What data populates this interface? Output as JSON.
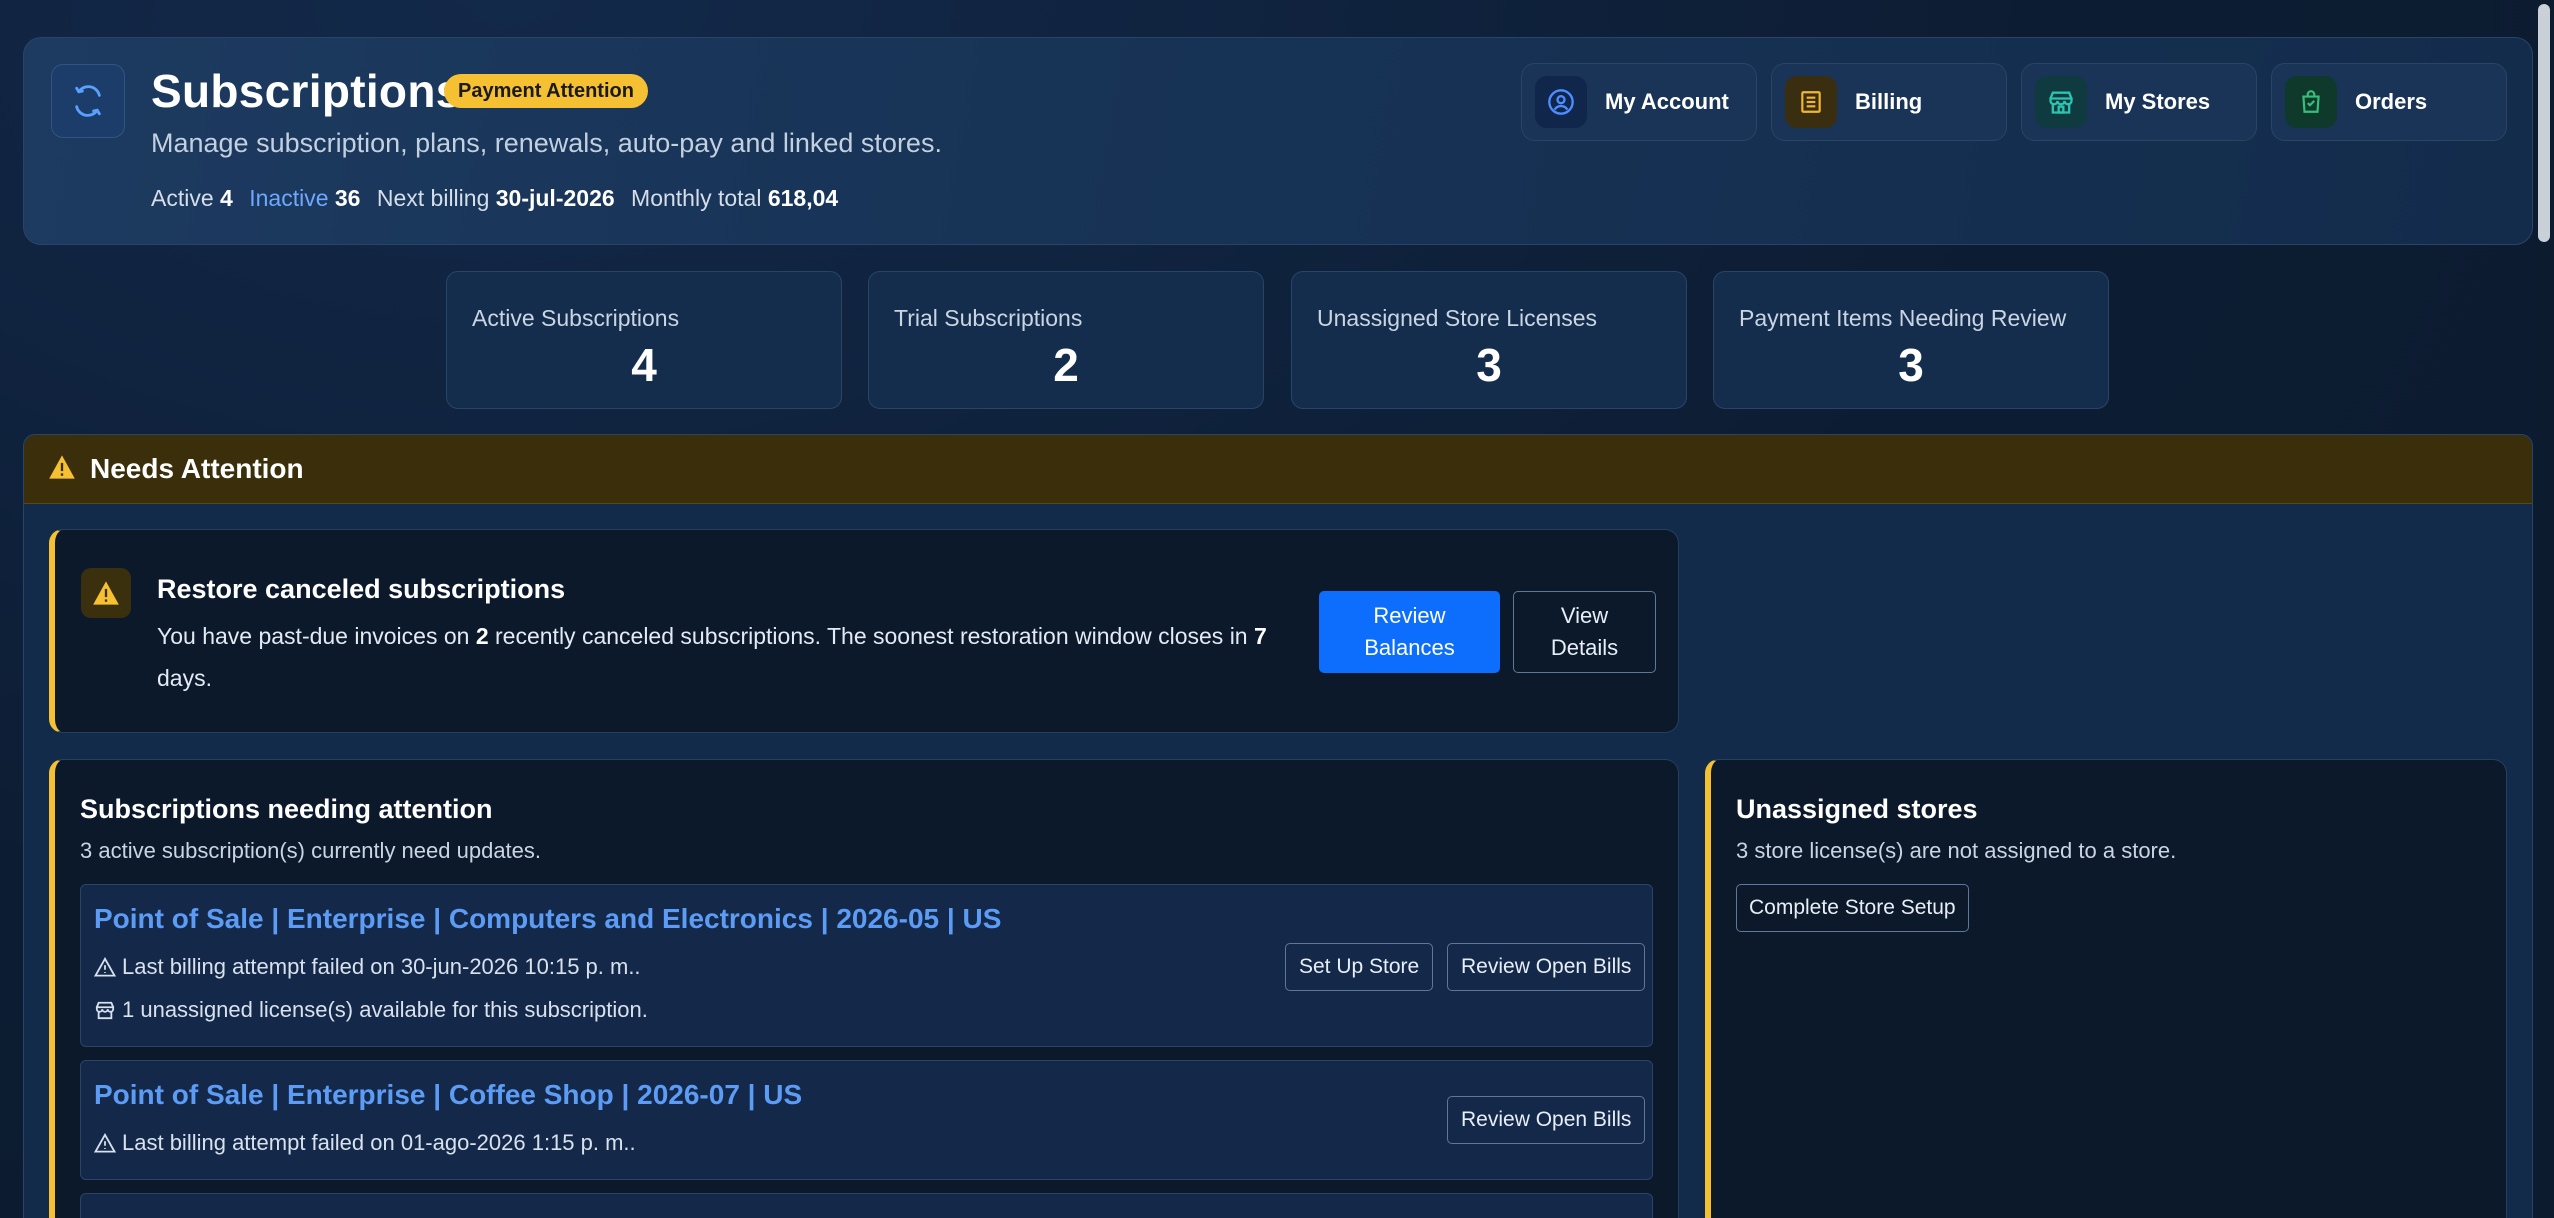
{
  "header": {
    "title": "Subscriptions",
    "badge": "Payment Attention",
    "subtitle": "Manage subscription, plans, renewals, auto-pay and linked stores.",
    "stats": {
      "active_label": "Active",
      "active_value": "4",
      "inactive_label": "Inactive",
      "inactive_value": "36",
      "next_billing_label": "Next billing",
      "next_billing_value": "30-jul-2026",
      "monthly_total_label": "Monthly total",
      "monthly_total_value": "618,04"
    },
    "nav": [
      {
        "label": "My Account",
        "icon": "user-circle-icon",
        "color": "#4d8dff"
      },
      {
        "label": "Billing",
        "icon": "receipt-icon",
        "color": "#f2b632"
      },
      {
        "label": "My Stores",
        "icon": "store-icon",
        "color": "#2bc4b0"
      },
      {
        "label": "Orders",
        "icon": "shopping-bag-icon",
        "color": "#35c07a"
      }
    ]
  },
  "metrics": [
    {
      "label": "Active Subscriptions",
      "value": "4"
    },
    {
      "label": "Trial Subscriptions",
      "value": "2"
    },
    {
      "label": "Unassigned Store Licenses",
      "value": "3"
    },
    {
      "label": "Payment Items Needing Review",
      "value": "3"
    }
  ],
  "attention": {
    "title": "Needs Attention",
    "restore": {
      "title": "Restore canceled subscriptions",
      "text_before": "You have past-due invoices on ",
      "count": "2",
      "text_middle": " recently canceled subscriptions. The soonest restoration window closes in ",
      "days": "7",
      "text_after": " days.",
      "primary_button": "Review Balances",
      "secondary_button": "View Details"
    }
  },
  "subscriptions_panel": {
    "title": "Subscriptions needing attention",
    "subtitle": "3 active subscription(s) currently need updates.",
    "items": [
      {
        "title": "Point of Sale | Enterprise | Computers and Electronics | 2026-05 | US",
        "billing_failed": "Last billing attempt failed on 30-jun-2026 10:15 p. m..",
        "license_note": "1 unassigned license(s) available for this subscription.",
        "button_setup": "Set Up Store",
        "button_bills": "Review Open Bills"
      },
      {
        "title": "Point of Sale | Enterprise | Coffee Shop | 2026-07 | US",
        "billing_failed": "Last billing attempt failed on 01-ago-2026 1:15 p. m..",
        "button_bills": "Review Open Bills"
      }
    ]
  },
  "unassigned_panel": {
    "title": "Unassigned stores",
    "subtitle": "3 store license(s) are not assigned to a store.",
    "button": "Complete Store Setup"
  },
  "colors": {
    "accent_yellow": "#f4c034",
    "primary_blue": "#0d6efd",
    "link_blue": "#5d9cf5"
  }
}
